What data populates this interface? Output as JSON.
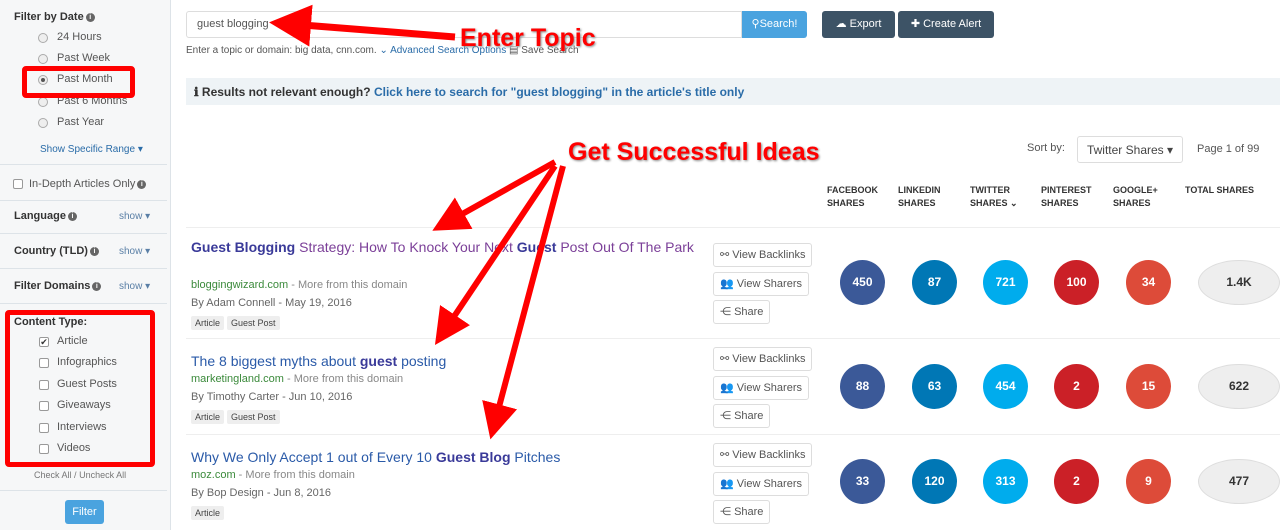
{
  "sidebar": {
    "date_title": "Filter by Date",
    "date_options": [
      "24 Hours",
      "Past Week",
      "Past Month",
      "Past 6 Months",
      "Past Year"
    ],
    "date_selected": "Past Month",
    "specific_range": "Show Specific Range",
    "in_depth": "In-Depth Articles Only",
    "language": "Language",
    "country": "Country (TLD)",
    "domains": "Filter Domains",
    "show": "show",
    "content_type_title": "Content Type:",
    "content_types": [
      "Article",
      "Infographics",
      "Guest Posts",
      "Giveaways",
      "Interviews",
      "Videos"
    ],
    "check_all": "Check All",
    "uncheck_all": "Uncheck All",
    "sep": "/",
    "filter_button": "Filter"
  },
  "search": {
    "value": "guest blogging",
    "button": "Search!",
    "hint": "Enter a topic or domain: big data, cnn.com.",
    "advanced": "Advanced Search Options",
    "save": "Save Search"
  },
  "toolbar": {
    "export": "Export",
    "create_alert": "Create Alert"
  },
  "notice": {
    "prefix": "Results not relevant enough?",
    "link": "Click here to search for \"guest blogging\" in the article's title only"
  },
  "sort": {
    "label": "Sort by:",
    "value": "Twitter Shares",
    "page": "Page 1 of 99"
  },
  "columns": [
    [
      "FACEBOOK",
      "SHARES"
    ],
    [
      "LINKEDIN",
      "SHARES"
    ],
    [
      "TWITTER",
      "SHARES"
    ],
    [
      "PINTEREST",
      "SHARES"
    ],
    [
      "GOOGLE+",
      "SHARES"
    ],
    [
      "TOTAL SHARES",
      ""
    ]
  ],
  "colors": {
    "facebook": "#3b5998",
    "linkedin": "#0077b5",
    "twitter": "#00aced",
    "pinterest": "#cb2027",
    "googleplus": "#dd4b39",
    "total": "#eeeeee",
    "annotation": "#ff0000"
  },
  "actions": {
    "backlinks": "View Backlinks",
    "sharers": "View Sharers",
    "share": "Share"
  },
  "results": [
    {
      "title_parts": [
        [
          "Guest Blogging",
          true
        ],
        [
          " Strategy: How To Knock Your Next ",
          false
        ],
        [
          "Guest",
          true
        ],
        [
          " Post Out Of The Park",
          false
        ]
      ],
      "domain": "bloggingwizard.com",
      "more": " - More from this domain",
      "author": "By Adam Connell - May 19, 2016",
      "tags": [
        "Article",
        "Guest Post"
      ],
      "shares": [
        "450",
        "87",
        "721",
        "100",
        "34",
        "1.4K"
      ]
    },
    {
      "title_parts": [
        [
          "The 8 biggest myths about ",
          false
        ],
        [
          "guest",
          true
        ],
        [
          " posting",
          false
        ]
      ],
      "domain": "marketingland.com",
      "more": " - More from this domain",
      "author": "By Timothy Carter - Jun 10, 2016",
      "tags": [
        "Article",
        "Guest Post"
      ],
      "shares": [
        "88",
        "63",
        "454",
        "2",
        "15",
        "622"
      ]
    },
    {
      "title_parts": [
        [
          "Why We Only Accept 1 out of Every 10 ",
          false
        ],
        [
          "Guest Blog",
          true
        ],
        [
          " Pitches",
          false
        ]
      ],
      "domain": "moz.com",
      "more": " - More from this domain",
      "author": "By Bop Design - Jun 8, 2016",
      "tags": [
        "Article"
      ],
      "shares": [
        "33",
        "120",
        "313",
        "2",
        "9",
        "477"
      ]
    }
  ],
  "annotations": {
    "enter_topic": "Enter Topic",
    "ideas": "Get Successful Ideas"
  }
}
